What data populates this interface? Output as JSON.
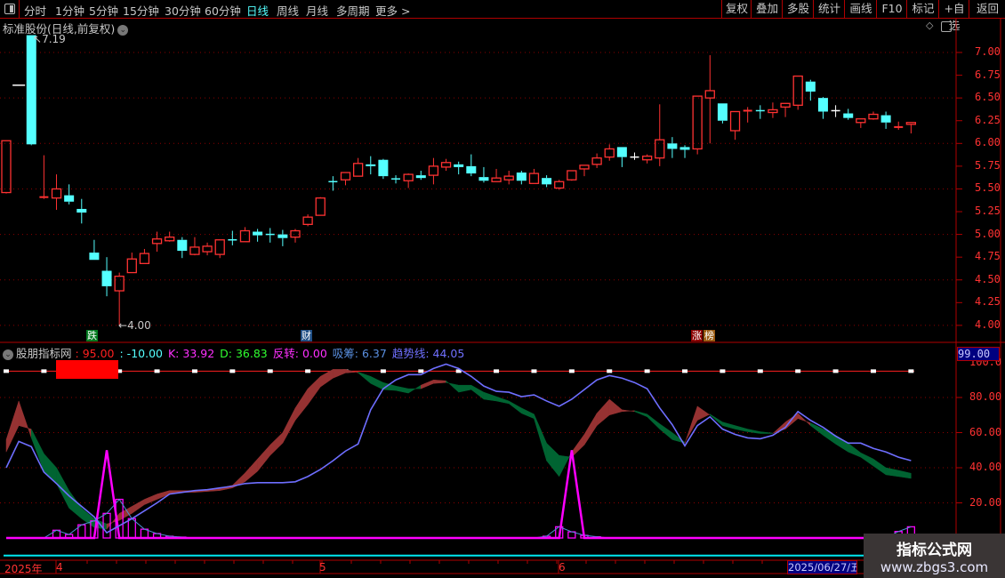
{
  "toolbar": {
    "periods": [
      {
        "label": "分时",
        "active": false
      },
      {
        "label": "1分钟",
        "active": false
      },
      {
        "label": "5分钟",
        "active": false
      },
      {
        "label": "15分钟",
        "active": false
      },
      {
        "label": "30分钟",
        "active": false
      },
      {
        "label": "60分钟",
        "active": false
      },
      {
        "label": "日线",
        "active": true
      },
      {
        "label": "周线",
        "active": false
      },
      {
        "label": "月线",
        "active": false
      },
      {
        "label": "多周期",
        "active": false
      },
      {
        "label": "更多 >",
        "active": false
      }
    ],
    "buttons": [
      "复权",
      "叠加",
      "多股",
      "统计",
      "画线",
      "F10",
      "标记",
      "+自选",
      "返回"
    ]
  },
  "main_chart": {
    "title": "标准股份(日线,前复权)",
    "high_label": "7.19",
    "low_label": "4.00",
    "price_ticks": [
      "7.00",
      "6.75",
      "6.50",
      "6.25",
      "6.00",
      "5.75",
      "5.50",
      "5.25",
      "5.00",
      "4.75",
      "4.50",
      "4.25",
      "4.00"
    ],
    "event_badges": [
      {
        "text": "跌",
        "color": "#007a1e"
      },
      {
        "text": "财",
        "color": "#1f4f86"
      },
      {
        "text": "涨",
        "color": "#8b0000"
      },
      {
        "text": "榜",
        "color": "#9a5a10"
      }
    ]
  },
  "indicator": {
    "name": "股朋指标网",
    "legend": [
      {
        "label": ": 95.00",
        "color": "#ff2020"
      },
      {
        "label": ": -10.00",
        "color": "#54ffff"
      },
      {
        "label": "K: 33.92",
        "color": "#ff30ff"
      },
      {
        "label": "D: 36.83",
        "color": "#30ff30"
      },
      {
        "label": "反转: 0.00",
        "color": "#ff30ff"
      },
      {
        "label": "吸筹: 6.37",
        "color": "#5a8fe0"
      },
      {
        "label": "趋势线: 44.05",
        "color": "#7070ff"
      }
    ],
    "current_value": "99.00",
    "value_ticks": [
      "100.0",
      "80.00",
      "60.00",
      "40.00",
      "20.00"
    ]
  },
  "date_axis": {
    "year": "2025年",
    "months": [
      "4",
      "5",
      "6"
    ],
    "cursor_date": "2025/06/27/五"
  },
  "watermark": {
    "line1": "指标公式网",
    "line2": "www.zbgs3.com"
  },
  "colors": {
    "up": "#ff3232",
    "down": "#54ffff",
    "flat": "#ffffff",
    "kd_up_fill": "#963232",
    "kd_down_fill": "#006432",
    "trend": "#6e6eff",
    "reversal": "#ff00ff",
    "accumulation": "#ff00ff",
    "grid": "#8b0000"
  },
  "chart_data": [
    {
      "type": "candlestick",
      "title": "标准股份(日线,前复权)",
      "ylim": [
        4.0,
        7.19
      ],
      "fields": [
        "open",
        "high",
        "low",
        "close",
        "dir"
      ],
      "candles": [
        [
          5.46,
          6.03,
          5.45,
          6.03,
          "up"
        ],
        [
          6.64,
          6.64,
          6.64,
          6.64,
          "flat"
        ],
        [
          7.19,
          7.19,
          5.98,
          5.99,
          "down"
        ],
        [
          5.4,
          5.87,
          5.39,
          5.41,
          "up"
        ],
        [
          5.4,
          5.66,
          5.27,
          5.5,
          "up"
        ],
        [
          5.43,
          5.55,
          5.33,
          5.36,
          "down"
        ],
        [
          5.28,
          5.39,
          5.12,
          5.24,
          "down"
        ],
        [
          4.8,
          4.94,
          4.72,
          4.72,
          "down"
        ],
        [
          4.6,
          4.75,
          4.32,
          4.43,
          "down"
        ],
        [
          4.38,
          4.58,
          4.0,
          4.54,
          "up"
        ],
        [
          4.58,
          4.8,
          4.58,
          4.73,
          "up"
        ],
        [
          4.68,
          4.84,
          4.68,
          4.79,
          "up"
        ],
        [
          4.9,
          5.03,
          4.81,
          4.95,
          "up"
        ],
        [
          4.93,
          5.03,
          4.92,
          4.97,
          "up"
        ],
        [
          4.94,
          4.97,
          4.74,
          4.82,
          "down"
        ],
        [
          4.78,
          4.97,
          4.77,
          4.86,
          "up"
        ],
        [
          4.81,
          4.91,
          4.77,
          4.87,
          "up"
        ],
        [
          4.78,
          4.94,
          4.74,
          4.94,
          "up"
        ],
        [
          4.94,
          5.04,
          4.88,
          4.94,
          "down"
        ],
        [
          4.92,
          5.08,
          4.92,
          5.04,
          "up"
        ],
        [
          5.03,
          5.06,
          4.92,
          4.99,
          "down"
        ],
        [
          5.0,
          5.07,
          4.91,
          5.0,
          "down"
        ],
        [
          5.0,
          5.05,
          4.87,
          4.96,
          "down"
        ],
        [
          4.97,
          5.06,
          4.91,
          5.04,
          "up"
        ],
        [
          5.11,
          5.22,
          5.09,
          5.19,
          "up"
        ],
        [
          5.21,
          5.41,
          5.21,
          5.4,
          "up"
        ],
        [
          5.58,
          5.64,
          5.48,
          5.58,
          "down"
        ],
        [
          5.6,
          5.68,
          5.54,
          5.68,
          "up"
        ],
        [
          5.64,
          5.84,
          5.64,
          5.78,
          "up"
        ],
        [
          5.77,
          5.86,
          5.66,
          5.75,
          "down"
        ],
        [
          5.82,
          5.83,
          5.61,
          5.64,
          "down"
        ],
        [
          5.61,
          5.65,
          5.56,
          5.61,
          "down"
        ],
        [
          5.59,
          5.67,
          5.51,
          5.66,
          "up"
        ],
        [
          5.65,
          5.7,
          5.6,
          5.62,
          "down"
        ],
        [
          5.65,
          5.84,
          5.55,
          5.75,
          "up"
        ],
        [
          5.74,
          5.83,
          5.7,
          5.79,
          "up"
        ],
        [
          5.77,
          5.8,
          5.66,
          5.74,
          "down"
        ],
        [
          5.75,
          5.88,
          5.64,
          5.67,
          "down"
        ],
        [
          5.63,
          5.74,
          5.57,
          5.59,
          "down"
        ],
        [
          5.58,
          5.72,
          5.58,
          5.62,
          "up"
        ],
        [
          5.6,
          5.7,
          5.55,
          5.64,
          "up"
        ],
        [
          5.68,
          5.7,
          5.55,
          5.59,
          "down"
        ],
        [
          5.56,
          5.72,
          5.56,
          5.67,
          "up"
        ],
        [
          5.62,
          5.65,
          5.52,
          5.55,
          "down"
        ],
        [
          5.51,
          5.6,
          5.49,
          5.58,
          "up"
        ],
        [
          5.6,
          5.7,
          5.59,
          5.7,
          "up"
        ],
        [
          5.72,
          5.76,
          5.64,
          5.76,
          "up"
        ],
        [
          5.77,
          5.89,
          5.73,
          5.84,
          "up"
        ],
        [
          5.85,
          5.99,
          5.81,
          5.94,
          "up"
        ],
        [
          5.96,
          5.96,
          5.74,
          5.85,
          "down"
        ],
        [
          5.85,
          5.9,
          5.82,
          5.85,
          "flat"
        ],
        [
          5.82,
          5.88,
          5.78,
          5.86,
          "up"
        ],
        [
          5.84,
          6.43,
          5.75,
          6.04,
          "up"
        ],
        [
          6.0,
          6.07,
          5.84,
          5.94,
          "down"
        ],
        [
          5.96,
          5.98,
          5.84,
          5.93,
          "down"
        ],
        [
          5.94,
          6.52,
          5.88,
          6.52,
          "up"
        ],
        [
          6.5,
          6.97,
          6.0,
          6.58,
          "up"
        ],
        [
          6.44,
          6.44,
          6.22,
          6.25,
          "down"
        ],
        [
          6.14,
          6.35,
          6.04,
          6.35,
          "up"
        ],
        [
          6.35,
          6.4,
          6.23,
          6.36,
          "up"
        ],
        [
          6.36,
          6.42,
          6.27,
          6.36,
          "down"
        ],
        [
          6.34,
          6.45,
          6.28,
          6.37,
          "up"
        ],
        [
          6.4,
          6.44,
          6.29,
          6.44,
          "up"
        ],
        [
          6.42,
          6.74,
          6.37,
          6.74,
          "up"
        ],
        [
          6.68,
          6.7,
          6.47,
          6.57,
          "down"
        ],
        [
          6.5,
          6.51,
          6.27,
          6.35,
          "down"
        ],
        [
          6.36,
          6.42,
          6.29,
          6.36,
          "flat"
        ],
        [
          6.33,
          6.38,
          6.26,
          6.28,
          "down"
        ],
        [
          6.23,
          6.27,
          6.17,
          6.27,
          "up"
        ],
        [
          6.27,
          6.35,
          6.26,
          6.32,
          "up"
        ],
        [
          6.31,
          6.35,
          6.16,
          6.23,
          "down"
        ],
        [
          6.18,
          6.24,
          6.15,
          6.18,
          "up"
        ],
        [
          6.21,
          6.23,
          6.11,
          6.23,
          "up"
        ]
      ]
    },
    {
      "type": "line",
      "title": "股朋指标网",
      "ylim": [
        -10,
        100
      ],
      "reference_lines": [
        95,
        -10
      ],
      "series": [
        {
          "name": "K",
          "values": [
            56,
            78,
            57,
            38,
            31,
            17,
            11,
            6,
            5,
            14,
            18,
            22,
            25,
            27,
            27,
            27,
            27.5,
            28.5,
            30,
            37,
            45,
            53,
            60,
            74,
            85,
            92,
            96,
            96,
            94,
            88,
            84.5,
            84,
            82.5,
            87,
            90,
            89.5,
            83,
            84.5,
            79,
            78,
            76.5,
            71,
            68,
            44,
            35,
            49,
            59,
            71,
            79,
            73,
            72,
            69,
            62,
            56,
            54,
            75,
            70,
            64,
            62,
            60.5,
            59.5,
            59.5,
            66,
            71,
            64,
            58.5,
            53.5,
            49,
            46,
            41,
            36,
            35,
            33.92
          ]
        },
        {
          "name": "D",
          "values": [
            49,
            64,
            62,
            48,
            40,
            27,
            17,
            11,
            8,
            10,
            14,
            19,
            22,
            25,
            26,
            26,
            26.5,
            27,
            28.5,
            32,
            38,
            47,
            54,
            67,
            76,
            86,
            91,
            94,
            94.5,
            92,
            88.5,
            86.5,
            85,
            85,
            88,
            88.5,
            87,
            87,
            83,
            80.5,
            78,
            74,
            70.5,
            54,
            47,
            46,
            53,
            64,
            70,
            72,
            72.5,
            70.5,
            65,
            60,
            54.5,
            67,
            70.5,
            66,
            64,
            62,
            60.5,
            59.7,
            62,
            68,
            65.5,
            62,
            58.5,
            54,
            48.5,
            45,
            40,
            38.5,
            36.83
          ]
        },
        {
          "name": "反转",
          "values": [
            0,
            0,
            0,
            0,
            0,
            0,
            0,
            0,
            50,
            0,
            0,
            0,
            0,
            0,
            0,
            0,
            0,
            0,
            0,
            0,
            0,
            0,
            0,
            0,
            0,
            0,
            0,
            0,
            0,
            0,
            0,
            0,
            0,
            0,
            0,
            0,
            0,
            0,
            0,
            0,
            0,
            0,
            0,
            0,
            0,
            50,
            0,
            0,
            0,
            0,
            0,
            0,
            0,
            0,
            0,
            0,
            0,
            0,
            0,
            0,
            0,
            0,
            0,
            0,
            0,
            0,
            0,
            0,
            0,
            0,
            0,
            0,
            0
          ]
        },
        {
          "name": "吸筹",
          "values": [
            0,
            0,
            0,
            0,
            4.4,
            2,
            7.5,
            9.7,
            14,
            22,
            11,
            5,
            2.5,
            1,
            0.5,
            0,
            0,
            0,
            0,
            0,
            0,
            0,
            0,
            0,
            0,
            0,
            0,
            0,
            0,
            0,
            0,
            0,
            0,
            0,
            0,
            0,
            0,
            0,
            0,
            0,
            0,
            0,
            0,
            1,
            6.4,
            3.5,
            1.5,
            0.7,
            0,
            0,
            0,
            0,
            0,
            0,
            0,
            0,
            0,
            0,
            0,
            0,
            0,
            0,
            0,
            0,
            0,
            0,
            0,
            0,
            0,
            0,
            0,
            3.7,
            6.37
          ]
        },
        {
          "name": "趋势线",
          "values": [
            40,
            55,
            52,
            37.5,
            31,
            24,
            18,
            12,
            3,
            7,
            11,
            15.5,
            20,
            25,
            26,
            27,
            27.5,
            28.5,
            29.5,
            31,
            31.5,
            31.5,
            31.5,
            32,
            35,
            39,
            44,
            49.5,
            53.5,
            73,
            85,
            90,
            93,
            93,
            96.5,
            99,
            96.5,
            92,
            86.5,
            83.5,
            83,
            80.5,
            81.5,
            78,
            75,
            79,
            84.5,
            90,
            92.5,
            91,
            88.5,
            85,
            74,
            64.5,
            52.5,
            64,
            69,
            62,
            59,
            57,
            56.5,
            58.5,
            63,
            72,
            67,
            63,
            58,
            54,
            54,
            51,
            49,
            46,
            44.05
          ]
        }
      ]
    }
  ]
}
